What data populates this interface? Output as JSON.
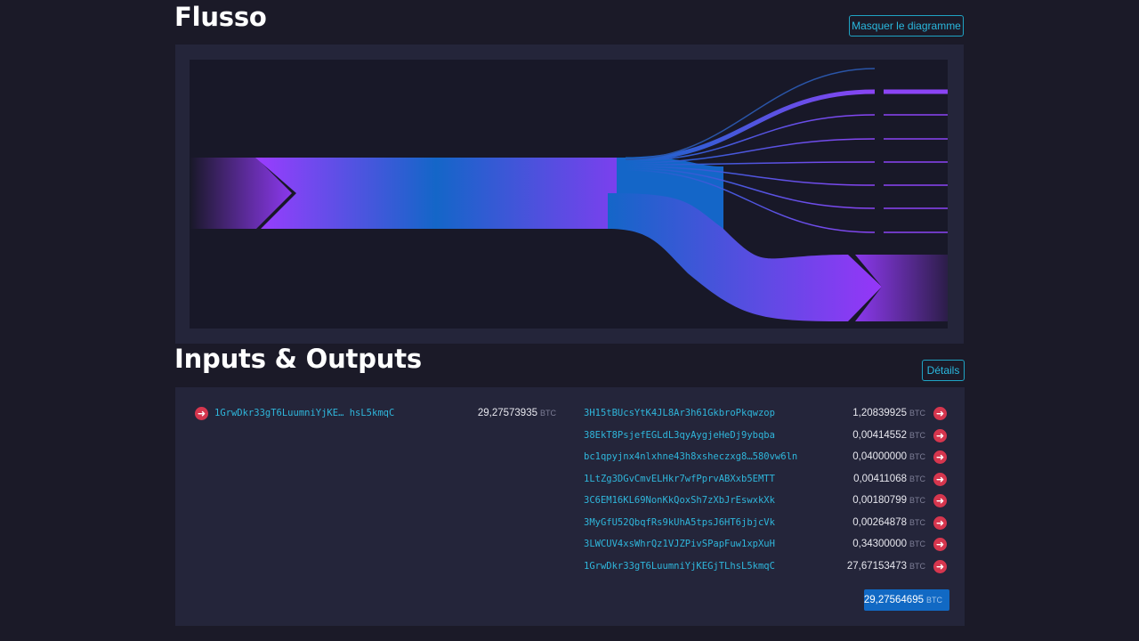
{
  "flow": {
    "title": "Flusso",
    "toggle_label": "Masquer le diagramme"
  },
  "io": {
    "title": "Inputs & Outputs",
    "details_label": "Détails",
    "unit": "BTC",
    "inputs": [
      {
        "address": "1GrwDkr33gT6LuumniYjKE… hsL5kmqC",
        "amount": "29,27573935"
      }
    ],
    "outputs": [
      {
        "address": "3H15tBUcsYtK4JL8Ar3h61GkbroPkqwzop",
        "amount": "1,20839925"
      },
      {
        "address": "38EkT8PsjefEGLdL3qyAygjeHeDj9ybqba",
        "amount": "0,00414552"
      },
      {
        "address": "bc1qpyjnx4nlxhne43h8xsheczxg8…580vw6ln",
        "amount": "0,04000000"
      },
      {
        "address": "1LtZg3DGvCmvELHkr7wfPprvABXxb5EMTT",
        "amount": "0,00411068"
      },
      {
        "address": "3C6EM16KL69NonKkQoxSh7zXbJrEswxkXk",
        "amount": "0,00180799"
      },
      {
        "address": "3MyGfU52QbqfRs9kUhA5tpsJ6HT6jbjcVk",
        "amount": "0,00264878"
      },
      {
        "address": "3LWCUV4xsWhrQz1VJZPivSPapFuw1xpXuH",
        "amount": "0,34300000"
      },
      {
        "address": "1GrwDkr33gT6LuumniYjKEGjTLhsL5kmqC",
        "amount": "27,67153473"
      }
    ],
    "total": "29,27564695"
  },
  "colors": {
    "accent_purple": "#9b3cff",
    "accent_blue": "#1169c4",
    "link_cyan": "#2fb6db",
    "arrow_red": "#d6364e"
  },
  "icons": {
    "row_arrow": "arrow-right-circle-icon"
  }
}
